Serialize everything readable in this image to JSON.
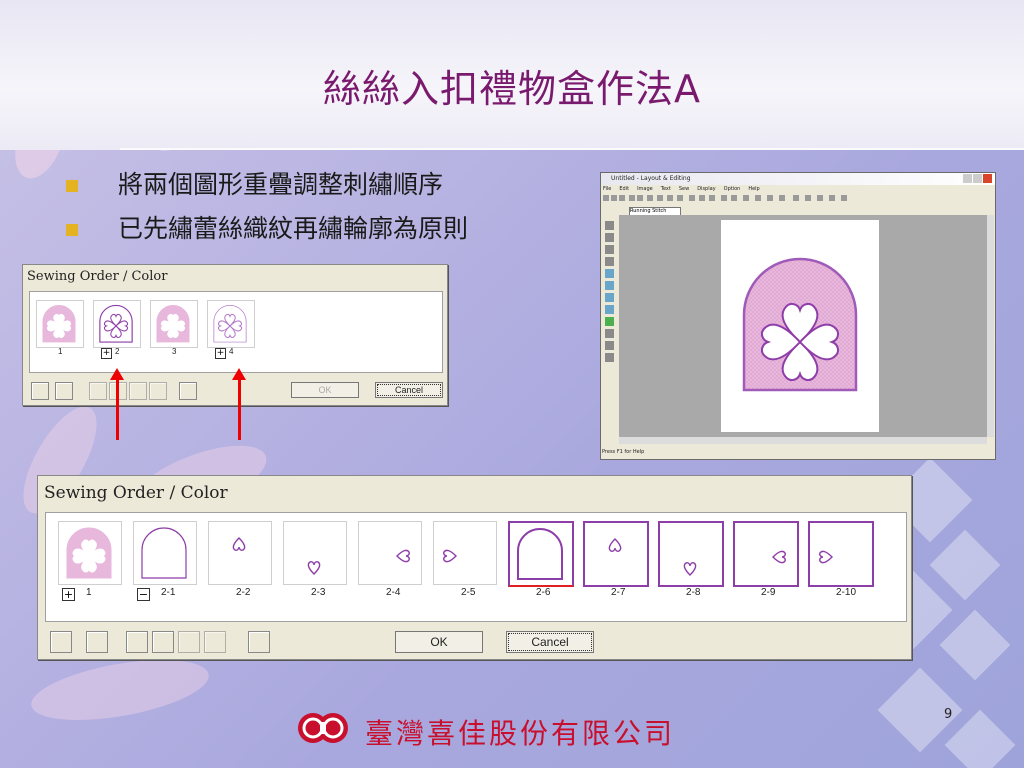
{
  "slide": {
    "title": "絲絲入扣禮物盒作法A",
    "bullets": [
      "將兩個圖形重疊調整刺繡順序",
      "已先繡蕾絲織紋再繡輪廓為原則"
    ],
    "page_number": "9",
    "footer_company": "臺灣喜佳股份有限公司"
  },
  "small_dialog": {
    "caption": "Sewing Order / Color",
    "items": [
      {
        "label": "1",
        "expander": "",
        "kind": "fill-heart"
      },
      {
        "label": "2",
        "expander": "+",
        "kind": "outline-heart"
      },
      {
        "label": "3",
        "expander": "",
        "kind": "fill-heart"
      },
      {
        "label": "4",
        "expander": "+",
        "kind": "outline-heart-light"
      }
    ],
    "ok_label": "OK",
    "cancel_label": "Cancel"
  },
  "large_dialog": {
    "caption": "Sewing Order / Color",
    "items": [
      {
        "label": "1",
        "expander": "+",
        "kind": "fill-heart"
      },
      {
        "label": "2-1",
        "expander": "−",
        "kind": "arch"
      },
      {
        "label": "2-2",
        "expander": "",
        "kind": "heart-top"
      },
      {
        "label": "2-3",
        "expander": "",
        "kind": "heart-bottom"
      },
      {
        "label": "2-4",
        "expander": "",
        "kind": "heart-right"
      },
      {
        "label": "2-5",
        "expander": "",
        "kind": "heart-left"
      },
      {
        "label": "2-6",
        "expander": "",
        "kind": "arch-selected"
      },
      {
        "label": "2-7",
        "expander": "",
        "kind": "heart-top-boxed"
      },
      {
        "label": "2-8",
        "expander": "",
        "kind": "heart-bottom-boxed"
      },
      {
        "label": "2-9",
        "expander": "",
        "kind": "heart-right-boxed"
      },
      {
        "label": "2-10",
        "expander": "",
        "kind": "heart-left-boxed"
      }
    ],
    "ok_label": "OK",
    "cancel_label": "Cancel"
  },
  "app_window": {
    "title": "Untitled - Layout & Editing",
    "menu": [
      "File",
      "Edit",
      "Image",
      "Text",
      "Sew",
      "Display",
      "Option",
      "Help"
    ],
    "stitch_select": "Running Stitch",
    "status": "Press F1 for Help"
  },
  "colors": {
    "title": "#7a1a6e",
    "bullet": "#e5b322",
    "pink_fill": "#e8b7dc",
    "outline_purple": "#8e3ea8",
    "arrow": "#ee0000",
    "footer": "#c8102e"
  }
}
